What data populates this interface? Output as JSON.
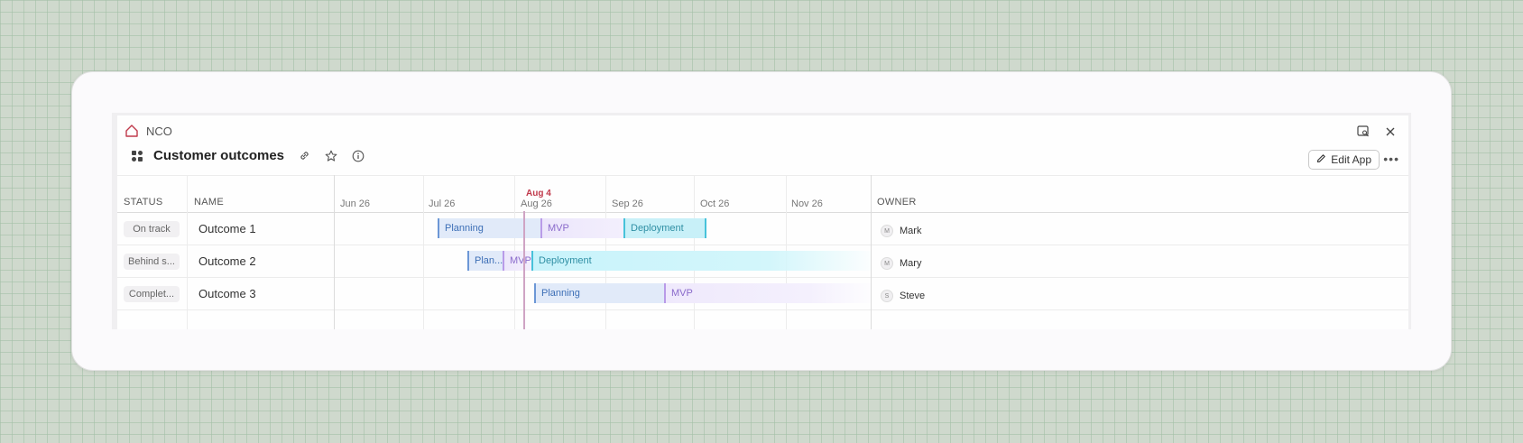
{
  "breadcrumb": {
    "label": "NCO"
  },
  "header": {
    "title": "Customer outcomes",
    "edit_label": "Edit App"
  },
  "columns": {
    "status": "STATUS",
    "name": "NAME",
    "owner": "OWNER"
  },
  "timeline": {
    "months": [
      "Jun 26",
      "Jul 26",
      "Aug 26",
      "Sep 26",
      "Oct 26",
      "Nov 26"
    ],
    "today_label": "Aug 4"
  },
  "rows": [
    {
      "status": "On track",
      "name": "Outcome 1",
      "owner": "Mark",
      "owner_initial": "M",
      "phases": [
        {
          "label": "Planning",
          "type": "planning"
        },
        {
          "label": "MVP",
          "type": "mvp"
        },
        {
          "label": "Deployment",
          "type": "deploy"
        }
      ]
    },
    {
      "status": "Behind s...",
      "name": "Outcome 2",
      "owner": "Mary",
      "owner_initial": "M",
      "phases": [
        {
          "label": "Plan...",
          "type": "planning"
        },
        {
          "label": "MVP",
          "type": "mvp"
        },
        {
          "label": "Deployment",
          "type": "deploy"
        }
      ]
    },
    {
      "status": "Complet...",
      "name": "Outcome 3",
      "owner": "Steve",
      "owner_initial": "S",
      "phases": [
        {
          "label": "Planning",
          "type": "planning"
        },
        {
          "label": "MVP",
          "type": "mvp"
        }
      ]
    }
  ],
  "icons": [
    "home-icon",
    "preview-icon",
    "close-icon",
    "app-grid-icon",
    "link-icon",
    "star-icon",
    "info-icon",
    "pencil-icon",
    "more-icon"
  ]
}
